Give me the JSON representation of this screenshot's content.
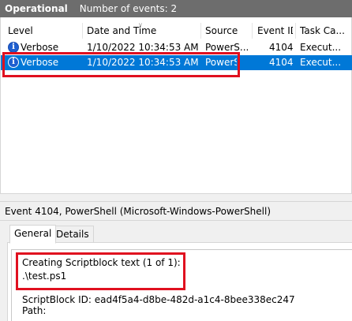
{
  "topbar": {
    "title": "Operational",
    "count": "Number of events: 2"
  },
  "grid": {
    "columns": [
      "Level",
      "Date and Time",
      "Source",
      "Event ID",
      "Task Ca..."
    ],
    "rows": [
      {
        "level": "Verbose",
        "datetime": "1/10/2022 10:34:53 AM",
        "source": "PowerS...",
        "event_id": "4104",
        "task": "Execut...",
        "selected": false
      },
      {
        "level": "Verbose",
        "datetime": "1/10/2022 10:34:53 AM",
        "source": "PowerS...",
        "event_id": "4104",
        "task": "Execut...",
        "selected": true
      }
    ]
  },
  "details": {
    "title": "Event 4104, PowerShell (Microsoft-Windows-PowerShell)",
    "tabs": [
      "General",
      "Details"
    ],
    "active_tab": "General",
    "lines": {
      "creating": "Creating Scriptblock text (1 of 1):",
      "script": ".\\test.ps1",
      "scriptblock_id": "ScriptBlock ID: ead4f5a4-d8be-482d-a1c4-8bee338ec247",
      "path": "Path:"
    }
  },
  "icons": {
    "level": "info-icon",
    "sort": "sort-caret-icon"
  },
  "colors": {
    "topbar": "#6d6d6d",
    "selection": "#0078d7",
    "highlight": "#e0101f",
    "info": "#1f5fd0"
  }
}
